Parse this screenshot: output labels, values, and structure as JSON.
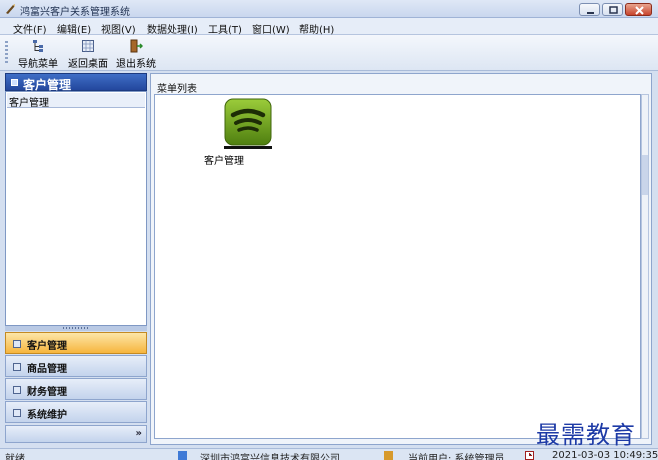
{
  "window": {
    "title": "鸿富兴客户关系管理系统"
  },
  "menu": [
    "文件(F)",
    "编辑(E)",
    "视图(V)",
    "数据处理(I)",
    "工具(T)",
    "窗口(W)",
    "帮助(H)"
  ],
  "toolbar": {
    "nav_menu": "导航菜单",
    "back_desktop": "返回桌面",
    "exit_system": "退出系统"
  },
  "sidebar": {
    "header": "客户管理",
    "tree_item": "客户管理",
    "nav": [
      {
        "label": "客户管理",
        "active": true
      },
      {
        "label": "商品管理",
        "active": false
      },
      {
        "label": "财务管理",
        "active": false
      },
      {
        "label": "系统维护",
        "active": false
      }
    ],
    "more": "»"
  },
  "content": {
    "title": "菜单列表",
    "tiles": [
      {
        "label": "客户管理",
        "icon": "wifi-signal-icon"
      }
    ]
  },
  "status": {
    "ready": "就绪",
    "company": "深圳市鸿富兴信息技术有限公司",
    "user": "当前用户: 系统管理员",
    "datetime": "2021-03-03 10:49:35"
  },
  "watermark": "最需教育",
  "colors": {
    "accent": "#23479d",
    "active_nav": "#f6b53e",
    "tile_green": "#6fa11d"
  }
}
